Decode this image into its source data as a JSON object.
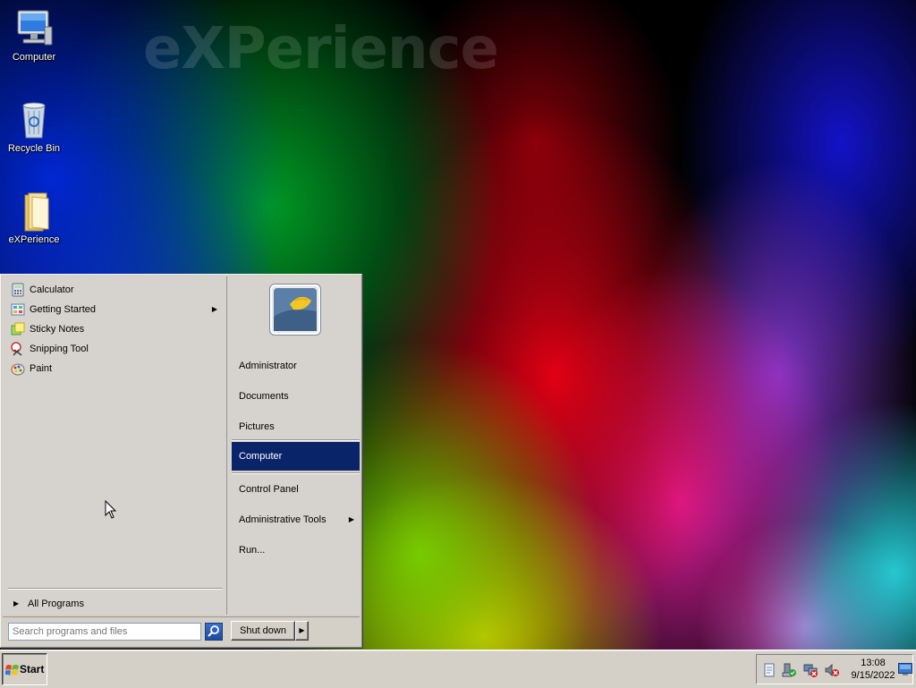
{
  "desktop": {
    "watermark": "eXPerience",
    "icons": [
      {
        "label": "Computer",
        "icon": "computer-icon"
      },
      {
        "label": "Recycle Bin",
        "icon": "recycle-bin-icon"
      },
      {
        "label": "eXPerience",
        "icon": "folder-icon"
      }
    ]
  },
  "start_menu": {
    "programs": [
      {
        "label": "Calculator",
        "icon": "calculator-icon",
        "has_submenu": false
      },
      {
        "label": "Getting Started",
        "icon": "getting-started-icon",
        "has_submenu": true
      },
      {
        "label": "Sticky Notes",
        "icon": "sticky-notes-icon",
        "has_submenu": false
      },
      {
        "label": "Snipping Tool",
        "icon": "snipping-tool-icon",
        "has_submenu": false
      },
      {
        "label": "Paint",
        "icon": "paint-icon",
        "has_submenu": false
      }
    ],
    "all_programs_label": "All Programs",
    "right_items": [
      {
        "label": "Administrator",
        "has_submenu": false,
        "selected": false
      },
      {
        "label": "Documents",
        "has_submenu": false,
        "selected": false
      },
      {
        "label": "Pictures",
        "has_submenu": false,
        "selected": false
      },
      {
        "label": "Computer",
        "has_submenu": false,
        "selected": true
      },
      {
        "label": "Control Panel",
        "has_submenu": false,
        "selected": false
      },
      {
        "label": "Administrative Tools",
        "has_submenu": true,
        "selected": false
      },
      {
        "label": "Run...",
        "has_submenu": false,
        "selected": false
      }
    ],
    "search_placeholder": "Search programs and files",
    "shutdown_label": "Shut down"
  },
  "taskbar": {
    "start_label": "Start",
    "clock_time": "13:08",
    "clock_date": "9/15/2022",
    "tray_icons": [
      "action-center-icon",
      "safely-remove-hardware-icon",
      "network-disconnected-icon",
      "volume-muted-icon"
    ]
  },
  "colors": {
    "selection": "#0a246a",
    "menu_bg": "#d4d0c8"
  }
}
